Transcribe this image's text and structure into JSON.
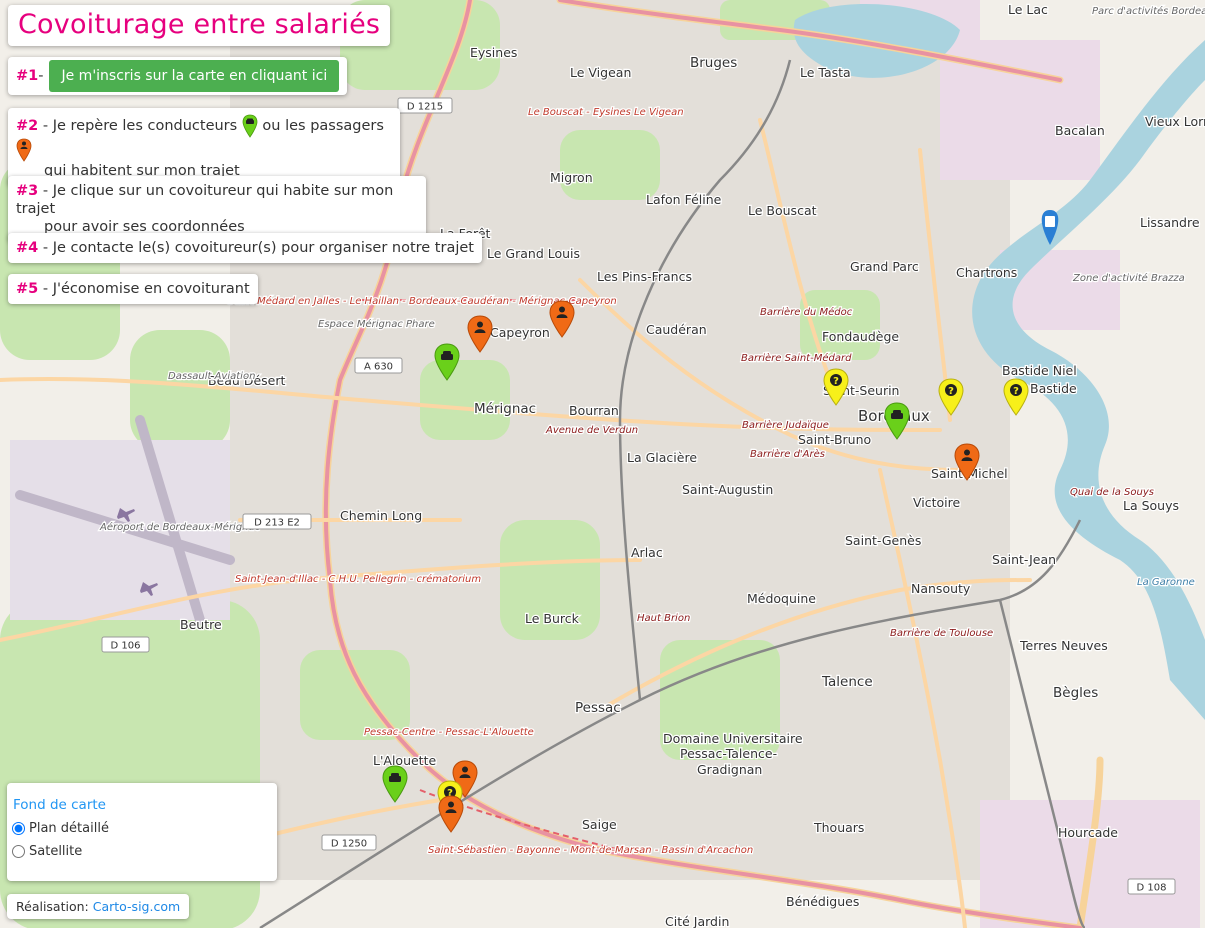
{
  "title": "Covoiturage entre salariés",
  "steps": {
    "s1_num": "#1",
    "s1_button": "Je m'inscris sur la carte en cliquant ici",
    "s2_num": "#2",
    "s2_text_a": "Je repère les conducteurs",
    "s2_text_b": "ou les passagers",
    "s2_text_c": "qui habitent sur mon trajet",
    "s3_num": "#3",
    "s3_text_a": "Je clique sur un covoitureur qui habite sur mon trajet",
    "s3_text_b": "pour avoir ses coordonnées",
    "s4_num": "#4",
    "s4_text": "Je contacte le(s) covoitureur(s) pour organiser notre trajet",
    "s5_num": "#5",
    "s5_text": "J'économise en covoiturant",
    "sep": " - "
  },
  "layers": {
    "title": "Fond de carte",
    "options": [
      "Plan détaillé",
      "Satellite"
    ],
    "selected": "Plan détaillé"
  },
  "credit": {
    "label": "Réalisation:",
    "link": "Carto-sig.com"
  },
  "colors": {
    "accent": "#e6007e",
    "button": "#4caf50",
    "driver": "#6ad01a",
    "passenger": "#f06a16",
    "unknown": "#f7f01a",
    "water": "#aad3df",
    "park": "#c8e6b0",
    "urban": "#e0dcd7"
  },
  "map_labels": [
    {
      "text": "Eysines",
      "kind": "place"
    },
    {
      "text": "Le Vigean",
      "kind": "place"
    },
    {
      "text": "Bruges",
      "kind": "town"
    },
    {
      "text": "Le Tasta",
      "kind": "place"
    },
    {
      "text": "Le Lac",
      "kind": "place"
    },
    {
      "text": "Bacalan",
      "kind": "place"
    },
    {
      "text": "Vieux Lormont",
      "kind": "place"
    },
    {
      "text": "Migron",
      "kind": "place"
    },
    {
      "text": "Lafon Féline",
      "kind": "place"
    },
    {
      "text": "Le Bouscat",
      "kind": "place"
    },
    {
      "text": "La Forêt",
      "kind": "place"
    },
    {
      "text": "Le Grand Louis",
      "kind": "place"
    },
    {
      "text": "Les Pins-Francs",
      "kind": "place"
    },
    {
      "text": "Grand Parc",
      "kind": "place"
    },
    {
      "text": "Chartrons",
      "kind": "place"
    },
    {
      "text": "Lissandre",
      "kind": "place"
    },
    {
      "text": "Capeyron",
      "kind": "place"
    },
    {
      "text": "Caudéran",
      "kind": "place"
    },
    {
      "text": "Fondaudège",
      "kind": "place"
    },
    {
      "text": "Bastide Niel",
      "kind": "place"
    },
    {
      "text": "Bastide",
      "kind": "place"
    },
    {
      "text": "Beau Désert",
      "kind": "place"
    },
    {
      "text": "Mérignac",
      "kind": "town"
    },
    {
      "text": "Bourran",
      "kind": "place"
    },
    {
      "text": "Saint-Seurin",
      "kind": "place"
    },
    {
      "text": "Bordeaux",
      "kind": "city"
    },
    {
      "text": "Saint-Bruno",
      "kind": "place"
    },
    {
      "text": "Saint-Michel",
      "kind": "place"
    },
    {
      "text": "La Glacière",
      "kind": "place"
    },
    {
      "text": "Saint-Augustin",
      "kind": "place"
    },
    {
      "text": "Victoire",
      "kind": "place"
    },
    {
      "text": "La Souys",
      "kind": "place"
    },
    {
      "text": "Chemin Long",
      "kind": "place"
    },
    {
      "text": "Saint-Genès",
      "kind": "place"
    },
    {
      "text": "Arlac",
      "kind": "place"
    },
    {
      "text": "Saint-Jean",
      "kind": "place"
    },
    {
      "text": "Nansouty",
      "kind": "place"
    },
    {
      "text": "Médoquine",
      "kind": "place"
    },
    {
      "text": "Le Burck",
      "kind": "place"
    },
    {
      "text": "Beutre",
      "kind": "place"
    },
    {
      "text": "Terres Neuves",
      "kind": "place"
    },
    {
      "text": "Talence",
      "kind": "town"
    },
    {
      "text": "Bègles",
      "kind": "town"
    },
    {
      "text": "Pessac",
      "kind": "town"
    },
    {
      "text": "Domaine Universitaire",
      "kind": "place"
    },
    {
      "text": "Pessac-Talence-",
      "kind": "place"
    },
    {
      "text": "Gradignan",
      "kind": "place"
    },
    {
      "text": "L'Alouette",
      "kind": "place"
    },
    {
      "text": "Saige",
      "kind": "place"
    },
    {
      "text": "Thouars",
      "kind": "place"
    },
    {
      "text": "Hourcade",
      "kind": "place"
    },
    {
      "text": "Bénédigues",
      "kind": "place"
    },
    {
      "text": "Cité Jardin",
      "kind": "place"
    },
    {
      "text": "Aéroport de Bordeaux-Mérignac",
      "kind": "poi"
    },
    {
      "text": "Dassault Aviation",
      "kind": "poi"
    },
    {
      "text": "Espace Mérignac Phare",
      "kind": "poi"
    },
    {
      "text": "Zone d'activité Brazza",
      "kind": "poi"
    },
    {
      "text": "Parc d'activités Bordeaux Grand Stade",
      "kind": "poi"
    },
    {
      "text": "Barrière du Médoc",
      "kind": "street"
    },
    {
      "text": "Barrière Saint-Médard",
      "kind": "street"
    },
    {
      "text": "Barrière Judaïque",
      "kind": "street"
    },
    {
      "text": "Barrière d'Arès",
      "kind": "street"
    },
    {
      "text": "Barrière de Toulouse",
      "kind": "street"
    },
    {
      "text": "Saint-Médard en Jalles - Le Haillan - Bordeaux-Caudéran - Mérignac-Capeyron",
      "kind": "tram"
    },
    {
      "text": "Saint-Jean-d'Illac - C.H.U. Pellegrin - crématorium",
      "kind": "tram"
    },
    {
      "text": "Saint-Sébastien - Bayonne - Mont-de-Marsan - Bassin d'Arcachon",
      "kind": "tram"
    },
    {
      "text": "Pessac-Centre - Pessac-L'Alouette",
      "kind": "tram"
    },
    {
      "text": "Le Bouscat - Eysines Le Vigean",
      "kind": "tram"
    },
    {
      "text": "A 630",
      "kind": "shield"
    },
    {
      "text": "D 1215",
      "kind": "shield"
    },
    {
      "text": "D 213 E2",
      "kind": "shield"
    },
    {
      "text": "D 106",
      "kind": "shield"
    },
    {
      "text": "D 1250",
      "kind": "shield"
    },
    {
      "text": "D 108",
      "kind": "shield"
    },
    {
      "text": "Avenue de Verdun",
      "kind": "street"
    },
    {
      "text": "Haut Brion",
      "kind": "street"
    },
    {
      "text": "Quai de la Souys",
      "kind": "street"
    },
    {
      "text": "La Garonne",
      "kind": "water"
    }
  ],
  "markers": [
    {
      "type": "passenger",
      "label": "passenger-marker"
    },
    {
      "type": "passenger",
      "label": "passenger-marker"
    },
    {
      "type": "driver",
      "label": "driver-marker"
    },
    {
      "type": "unknown",
      "label": "unknown-marker"
    },
    {
      "type": "unknown",
      "label": "unknown-marker"
    },
    {
      "type": "unknown",
      "label": "unknown-marker"
    },
    {
      "type": "driver",
      "label": "driver-marker"
    },
    {
      "type": "passenger",
      "label": "passenger-marker"
    },
    {
      "type": "driver",
      "label": "driver-marker"
    },
    {
      "type": "passenger",
      "label": "passenger-marker"
    },
    {
      "type": "unknown",
      "label": "unknown-marker"
    },
    {
      "type": "passenger",
      "label": "passenger-marker"
    }
  ]
}
